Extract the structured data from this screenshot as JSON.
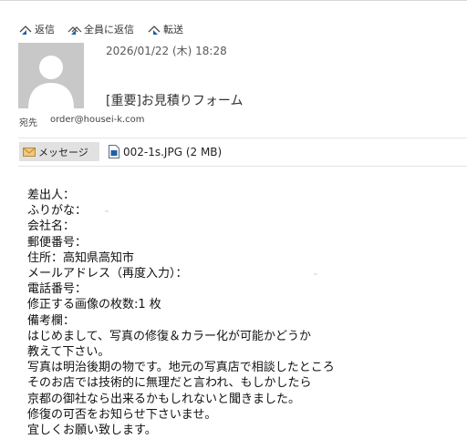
{
  "toolbar": {
    "reply_label": "返信",
    "reply_all_label": "全員に返信",
    "forward_label": "転送"
  },
  "header": {
    "datetime": "2026/01/22 (木) 18:28",
    "subject": "[重要]お見積りフォーム",
    "to_label": "宛先",
    "to_address": "order@housei-k.com"
  },
  "attachments": {
    "message_tab_label": "メッセージ",
    "file_name": "002-1s.JPG (2 MB)"
  },
  "body_lines": [
    "差出人：",
    "ふりがな：",
    "会社名：",
    "郵便番号：",
    "住所：高知県高知市",
    "メールアドレス（再度入力）：",
    "電話番号：",
    "修正する画像の枚数:1 枚",
    "備考欄：",
    "はじめまして、写真の修復＆カラー化が可能かどうか",
    "教えて下さい。",
    "写真は明治後期の物です。地元の写真店で相談したところ",
    "そのお店では技術的に無理だと言われ、もしかしたら",
    "京都の御社なら出来るかもしれないと聞きました。",
    "修復の可否をお知らせ下さいませ。",
    "宜しくお願い致します。"
  ],
  "colors": {
    "accent_blue": "#1f5fa8",
    "message_tab_bg": "#e1e1e1",
    "avatar_bg": "#c8c8c8"
  },
  "icons": {
    "reply": "reply-icon",
    "reply_all": "reply-all-icon",
    "forward": "forward-icon",
    "envelope": "envelope-icon",
    "file": "image-file-icon",
    "avatar": "person-silhouette-icon"
  }
}
